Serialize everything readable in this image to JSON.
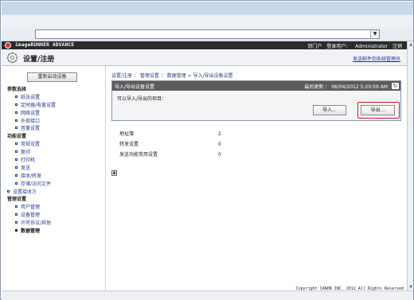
{
  "browser": {
    "address_dropdown": "▼"
  },
  "brand": {
    "name": "imageRUNNER ADVANCE",
    "portal": "到门户",
    "login_label": "登录用户：",
    "user": "Administrator",
    "logout": "注销"
  },
  "header": {
    "title": "设置/注册",
    "link": "发送邮件到系统管理员"
  },
  "sidebar": {
    "restart_button": "重新启动设备",
    "sections": [
      {
        "heading": "参数选择",
        "items": [
          "纸张设置",
          "定时器/电量设置",
          "网络设置",
          "外部接口",
          "音量设置"
        ]
      },
      {
        "heading": "功能设置",
        "items": [
          "常规设置",
          "复印",
          "打印机",
          "发送",
          "接收/转发",
          "存储/访问文件"
        ]
      },
      {
        "top_item": "设置接收方"
      },
      {
        "heading": "管理设置",
        "items": [
          "用户管理",
          "设备管理",
          "许可协议/其他",
          "数据管理"
        ]
      }
    ],
    "active_item": "数据管理"
  },
  "main": {
    "breadcrumb": "设置/注册 ： 管理设置 ： 数据管理 > 导入/导出设备设置",
    "panel": {
      "title": "导入/导出设备设置",
      "last_updated": "最后更新 ： 06/04/2012 5:20:59 AM",
      "refresh_icon": "refresh-icon",
      "subtitle": "可以导入/导出的项目：",
      "import_button": "导入...",
      "export_button": "导出...",
      "highlight_color": "#d71920"
    },
    "table": [
      {
        "name": "地址簿",
        "value": "2"
      },
      {
        "name": "转发设置",
        "value": "0"
      },
      {
        "name": "发送功能常用设置",
        "value": "0"
      }
    ],
    "copyright": "Copyright CANON INC. 2012 All Rights Reserved"
  }
}
